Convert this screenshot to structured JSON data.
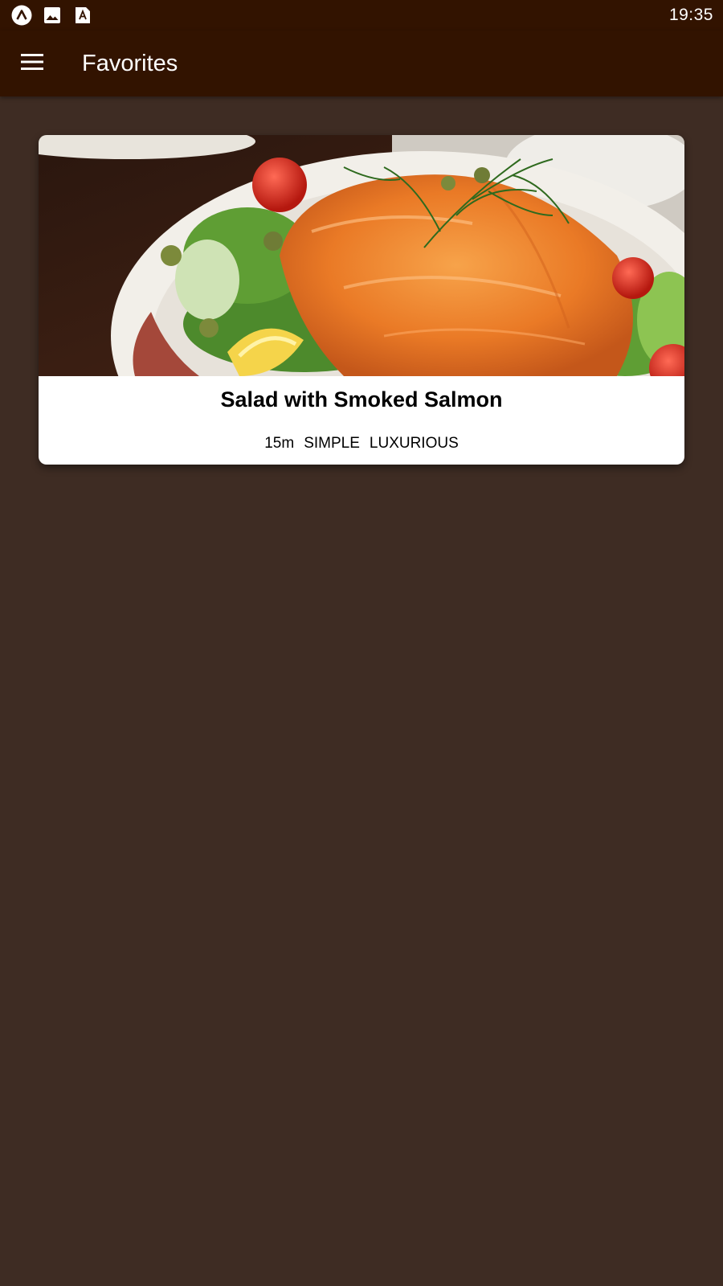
{
  "status_bar": {
    "time": "19:35",
    "icons": [
      "app-logo-icon",
      "image-icon",
      "font-icon"
    ]
  },
  "app_bar": {
    "title": "Favorites",
    "menu_icon": "hamburger-menu-icon"
  },
  "favorites": [
    {
      "title": "Salad with Smoked Salmon",
      "duration": "15m",
      "complexity": "SIMPLE",
      "affordability": "LUXURIOUS"
    }
  ]
}
